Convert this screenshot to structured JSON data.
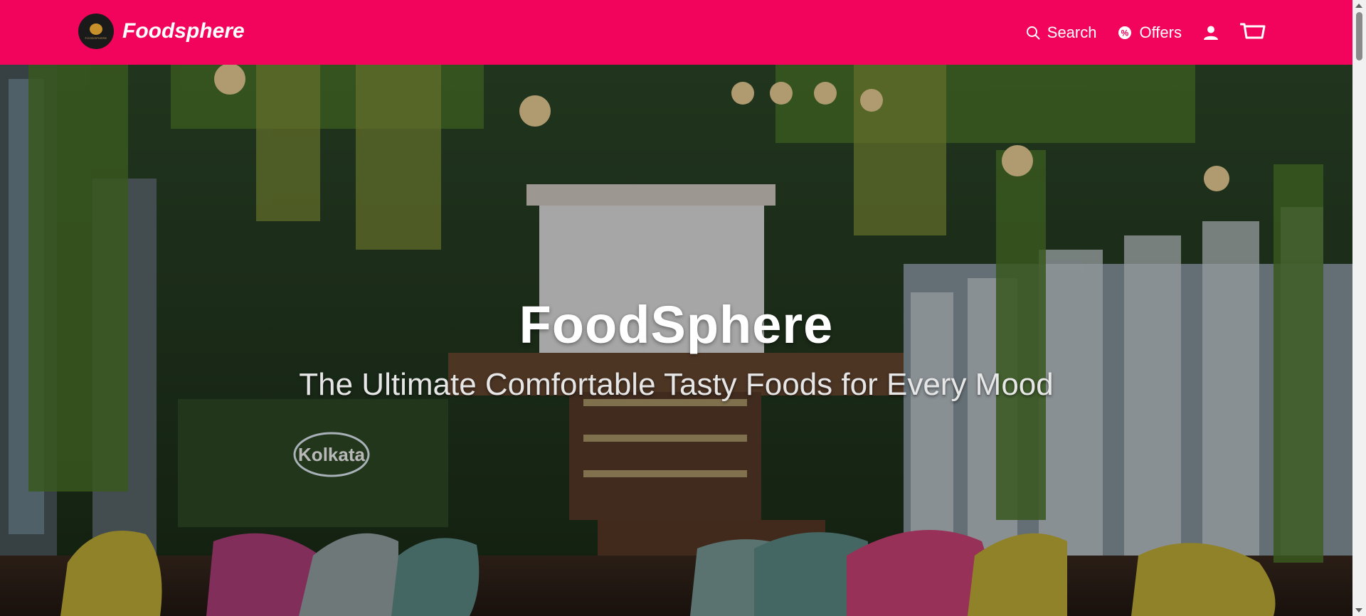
{
  "header": {
    "brand_name": "Foodsphere",
    "logo_text": "FOODSPHERE",
    "nav": {
      "search_label": "Search",
      "offers_label": "Offers"
    },
    "icons": [
      "search-icon",
      "offers-icon",
      "user-icon",
      "cart-icon"
    ]
  },
  "hero": {
    "title": "FoodSphere",
    "subtitle": "The Ultimate Comfortable Tasty Foods for Every Mood",
    "sign_text": "Kolkata"
  },
  "colors": {
    "header_bg": "#f2045c",
    "text": "#ffffff"
  }
}
